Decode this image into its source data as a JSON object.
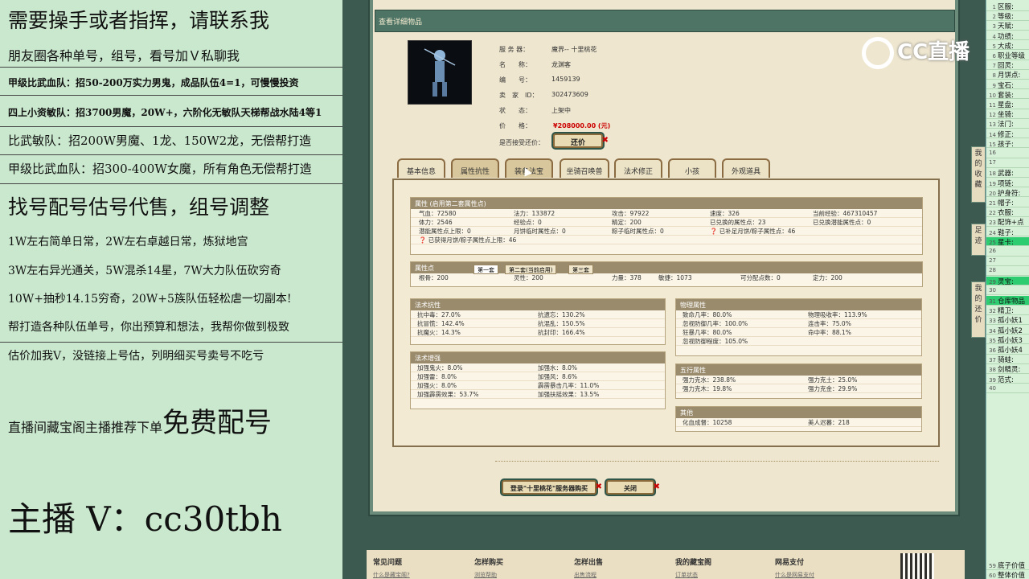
{
  "left": {
    "line1": "需要操手或者指挥，请联系我",
    "line2": "朋友圈各种单号，组号，看号加Ｖ私聊我",
    "line3": "甲级比武血队：招50-200万实力男鬼，成品队伍4=1，可慢慢投资",
    "line4": "四上小资敏队：招3700男魔，20W+，六阶化无敏队天梯帮战水陆4等1",
    "line5": "比武敏队：招200W男魔、1龙、150W2龙，无偿帮打造",
    "line6": "甲级比武血队：招300-400W女魔，所有角色无偿帮打造",
    "line7": "找号配号估号代售，组号调整",
    "line8": "1W左右简单日常，2W左右卓越日常，炼狱地宫",
    "line9": "3W左右异光通关，5W混杀14星，7W大力队伍砍穷奇",
    "line10": "10W+抽秒14.15穷奇，20W+5族队伍轻松虐一切副本!",
    "line11": "帮打造各种队伍单号，你出预算和想法，我帮你做到极致",
    "line12": "估价加我V，没链接上号估，列明细买号卖号不吃亏",
    "line13a": "直播间藏宝阁主播推荐下单",
    "line13b": "免费配号",
    "line14": "主播 V：cc30tbh"
  },
  "game": {
    "window_title": "查看详细物品",
    "watermark": "CC直播",
    "info": {
      "server_label": "服 务 器：",
      "server": "魔界-- 十里桃花",
      "name_label": "名　　称：",
      "name": "龙渊客",
      "id_label": "编　　号：",
      "id": "1459139",
      "seller_label": "卖　家　ID：",
      "seller": "302473609",
      "status_label": "状　　态：",
      "status": "上架中",
      "price_label": "价　　格：",
      "price": "¥208000.00 (元)",
      "bargain_label": "是否接受还价：",
      "bargain_btn": "还价"
    },
    "tabs": [
      "基本信息",
      "属性抗性",
      "装备法宝",
      "坐骑召唤兽",
      "法术修正",
      "小孩",
      "外观道具"
    ],
    "attr_title": "属性 (启用第二套属性点)",
    "attr_rows": [
      [
        "气血：72580",
        "法力：133872",
        "攻击：97922",
        "速度：326",
        "当前经验：467310457"
      ],
      [
        "体力：2546",
        "经验点：0",
        "精定：200",
        "已兑换的属性点：23",
        "已兑换潜能属性点：0"
      ],
      [
        "潜能属性点上限：0",
        "月饼临时属性点：0",
        "粽子临时属性点：0",
        "❓ 已补足月饼/粽子属性点：46",
        ""
      ],
      [
        "❓ 已获得月饼/粽子属性点上限：46",
        "",
        "",
        "",
        ""
      ]
    ],
    "points_title": "属性点",
    "points_tabs": [
      "第一套",
      "第二套(当前启用)",
      "第三套"
    ],
    "points": [
      "根骨：200",
      "灵性：200",
      "力量：378",
      "敏捷：1073",
      "可分配点数：0",
      "定力：200"
    ],
    "resist_title": "法术抗性",
    "resist": [
      [
        "抗中毒：27.0%",
        "抗遗忘：130.2%"
      ],
      [
        "抗冒慌：142.4%",
        "抗混乱：150.5%"
      ],
      [
        "抗魔火：14.3%",
        "抗封印：166.4%"
      ]
    ],
    "enh_title": "法术增强",
    "enh": [
      [
        "加强鬼火：8.0%",
        "加强水：8.0%"
      ],
      [
        "加强雷：8.0%",
        "加强风：8.6%"
      ],
      [
        "加强火：8.0%",
        "霹雳暴击几率：11.0%"
      ],
      [
        "加强霹雳效果：53.7%",
        "加强扶摇效果：13.5%"
      ]
    ],
    "phys_title": "物理属性",
    "phys": [
      [
        "致命几率：80.0%",
        "物理吸收率：113.9%"
      ],
      [
        "忽视防御几率：100.0%",
        "连击率：75.0%"
      ],
      [
        "狂暴几率：80.0%",
        "命中率：88.1%"
      ],
      [
        "忽视防御程度：105.0%",
        ""
      ]
    ],
    "five_title": "五行属性",
    "five": [
      [
        "强力克水：238.8%",
        "强力克土：25.0%"
      ],
      [
        "强力克木：19.8%",
        "强力克金：29.9%"
      ]
    ],
    "other_title": "其他",
    "other": [
      "化血成督：10258",
      "美人迟暮：218"
    ],
    "buy_btn": "登录\"十里桃花\"服务器购买",
    "close_btn": "关闭",
    "side1": "我的收藏",
    "side2": "足迹",
    "side3": "我的还价",
    "footer": [
      {
        "t": "常见问题",
        "s": "什么是藏宝阁?"
      },
      {
        "t": "怎样购买",
        "s": "浏览帮助"
      },
      {
        "t": "怎样出售",
        "s": "出售流程"
      },
      {
        "t": "我的藏宝阁",
        "s": "订单状态"
      },
      {
        "t": "网易支付",
        "s": "什么是网易支付"
      }
    ]
  },
  "rightpanel": [
    {
      "n": "1",
      "t": "区服:"
    },
    {
      "n": "2",
      "t": "等级:"
    },
    {
      "n": "3",
      "t": "天赋:"
    },
    {
      "n": "4",
      "t": "功绩:"
    },
    {
      "n": "5",
      "t": "大成:"
    },
    {
      "n": "6",
      "t": "职业等级"
    },
    {
      "n": "7",
      "t": "回灵:"
    },
    {
      "n": "8",
      "t": "月饼点:"
    },
    {
      "n": "9",
      "t": "宝石:"
    },
    {
      "n": "10",
      "t": "套装:"
    },
    {
      "n": "11",
      "t": "星盘:"
    },
    {
      "n": "12",
      "t": "坐骑:"
    },
    {
      "n": "13",
      "t": "法门:"
    },
    {
      "n": "14",
      "t": "修正:"
    },
    {
      "n": "15",
      "t": "孩子:"
    },
    {
      "n": "16",
      "t": ""
    },
    {
      "n": "17",
      "t": ""
    },
    {
      "n": "18",
      "t": "武器:"
    },
    {
      "n": "19",
      "t": "项链:"
    },
    {
      "n": "20",
      "t": "护身符:"
    },
    {
      "n": "21",
      "t": "帽子:"
    },
    {
      "n": "22",
      "t": "衣服:"
    },
    {
      "n": "23",
      "t": "配饰+点"
    },
    {
      "n": "24",
      "t": "鞋子:"
    },
    {
      "n": "25",
      "t": "星卡:",
      "hl": true
    },
    {
      "n": "26",
      "t": ""
    },
    {
      "n": "27",
      "t": ""
    },
    {
      "n": "28",
      "t": ""
    },
    {
      "n": "29",
      "t": "灵宝:",
      "hl": true
    },
    {
      "n": "30",
      "t": ""
    },
    {
      "n": "31",
      "t": "仓库物品",
      "hl": true
    },
    {
      "n": "32",
      "t": "精卫:"
    },
    {
      "n": "33",
      "t": "孤小妖1"
    },
    {
      "n": "34",
      "t": "孤小妖2"
    },
    {
      "n": "35",
      "t": "孤小妖3"
    },
    {
      "n": "36",
      "t": "孤小妖4"
    },
    {
      "n": "37",
      "t": "骑蛙:"
    },
    {
      "n": "38",
      "t": "剑精灵:"
    },
    {
      "n": "39",
      "t": "范式:"
    },
    {
      "n": "40",
      "t": ""
    },
    {
      "n": "59",
      "t": "底子价值"
    },
    {
      "n": "60",
      "t": "整体价值"
    }
  ]
}
